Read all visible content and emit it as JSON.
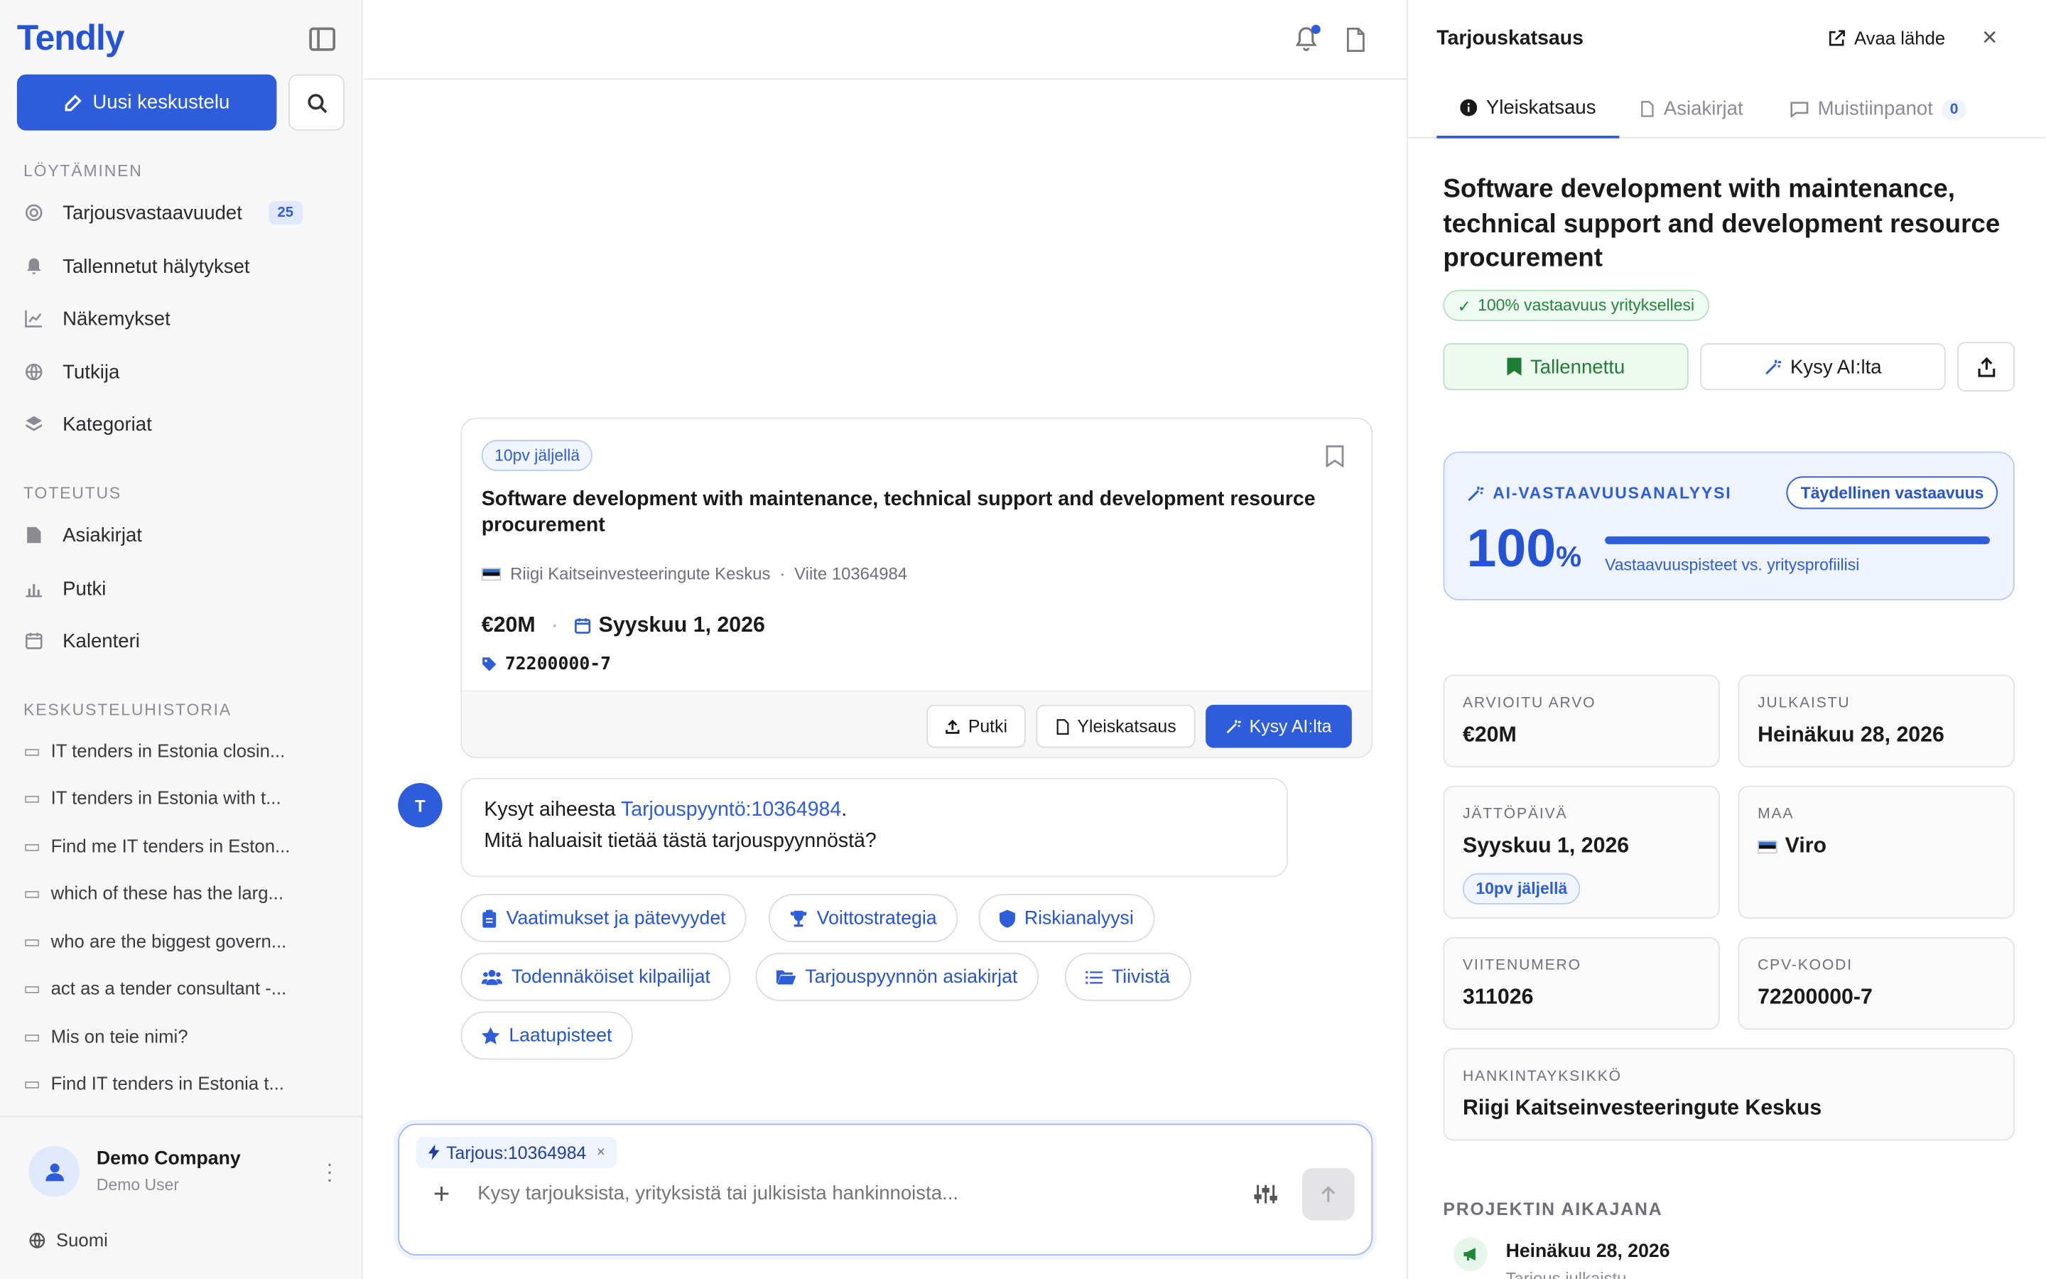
{
  "sidebar": {
    "logo": "Tendly",
    "new_chat_label": "Uusi keskustelu",
    "section_discovery": "Löytäminen",
    "section_execution": "Toteutus",
    "section_history": "Keskusteluhistoria",
    "discovery_items": [
      {
        "label": "Tarjousvastaavuudet",
        "badge": "25",
        "icon": "target-icon"
      },
      {
        "label": "Tallennetut hälytykset",
        "icon": "bell-icon"
      },
      {
        "label": "Näkemykset",
        "icon": "chart-line-icon"
      },
      {
        "label": "Tutkija",
        "icon": "globe-icon"
      },
      {
        "label": "Kategoriat",
        "icon": "layers-icon"
      }
    ],
    "execution_items": [
      {
        "label": "Asiakirjat",
        "icon": "file-edit-icon"
      },
      {
        "label": "Putki",
        "icon": "bar-chart-icon"
      },
      {
        "label": "Kalenteri",
        "icon": "calendar-icon"
      }
    ],
    "history": [
      "IT tenders in Estonia closin...",
      "IT tenders in Estonia with t...",
      "Find me IT tenders in Eston...",
      "which of these has the larg...",
      "who are the biggest govern...",
      "act as a tender consultant -...",
      "Mis on teie nimi?",
      "Find IT tenders in Estonia t..."
    ],
    "company": "Demo Company",
    "user": "Demo User",
    "language": "Suomi"
  },
  "chat": {
    "card": {
      "days_left": "10pv jäljellä",
      "title": "Software development with maintenance, technical support and development resource procurement",
      "buyer": "Riigi Kaitseinvesteeringute Keskus",
      "reference": "Viite 10364984",
      "value": "€20M",
      "deadline": "Syyskuu 1, 2026",
      "cpv": "72200000-7",
      "btn_pipeline": "Putki",
      "btn_overview": "Yleiskatsaus",
      "btn_ask_ai": "Kysy AI:lta"
    },
    "user_initial": "T",
    "message_prefix": "Kysyt aiheesta ",
    "message_link": "Tarjouspyyntö:10364984",
    "message_suffix": ".",
    "message_line2": "Mitä haluaisit tietää tästä tarjouspyynnöstä?",
    "chips": [
      "Vaatimukset ja pätevyydet",
      "Voittostrategia",
      "Riskianalyysi",
      "Todennäköiset kilpailijat",
      "Tarjouspyynnön asiakirjat",
      "Tiivistä",
      "Laatupisteet"
    ],
    "context_pill": "Tarjous:10364984",
    "input_placeholder": "Kysy tarjouksista, yrityksistä tai julkisista hankinnoista..."
  },
  "panel": {
    "title": "Tarjouskatsaus",
    "open_source": "Avaa lähde",
    "tabs": [
      {
        "label": "Yleiskatsaus",
        "active": true
      },
      {
        "label": "Asiakirjat",
        "active": false
      },
      {
        "label": "Muistiinpanot",
        "count": "0",
        "active": false
      }
    ],
    "heading": "Software development with maintenance, technical support and development resource procurement",
    "match_badge": "100% vastaavuus yrityksellesi",
    "btn_saved": "Tallennettu",
    "btn_ask_ai": "Kysy AI:lta",
    "ai_title": "AI-VASTAAVUUSANALYYSI",
    "ai_pill": "Täydellinen vastaavuus",
    "ai_score": "100",
    "ai_pct": "%",
    "ai_progress": 1.0,
    "ai_sub": "Vastaavuuspisteet vs. yritysprofiilisi",
    "stats": {
      "value_label": "Arvioitu arvo",
      "value": "€20M",
      "published_label": "Julkaistu",
      "published": "Heinäkuu 28, 2026",
      "deadline_label": "Jättöpäivä",
      "deadline": "Syyskuu 1, 2026",
      "deadline_badge": "10pv jäljellä",
      "country_label": "Maa",
      "country": "Viro",
      "ref_label": "Viitenumero",
      "ref": "311026",
      "cpv_label": "CPV-koodi",
      "cpv": "72200000-7",
      "buyer_label": "Hankintayksikkö",
      "buyer": "Riigi Kaitseinvesteeringute Keskus"
    },
    "timeline_title": "PROJEKTIN AIKAJANA",
    "timeline_date": "Heinäkuu 28, 2026",
    "timeline_sub": "Tarjous julkaistu"
  },
  "colors": {
    "accent": "#2d5ddb",
    "success": "#22863a"
  }
}
